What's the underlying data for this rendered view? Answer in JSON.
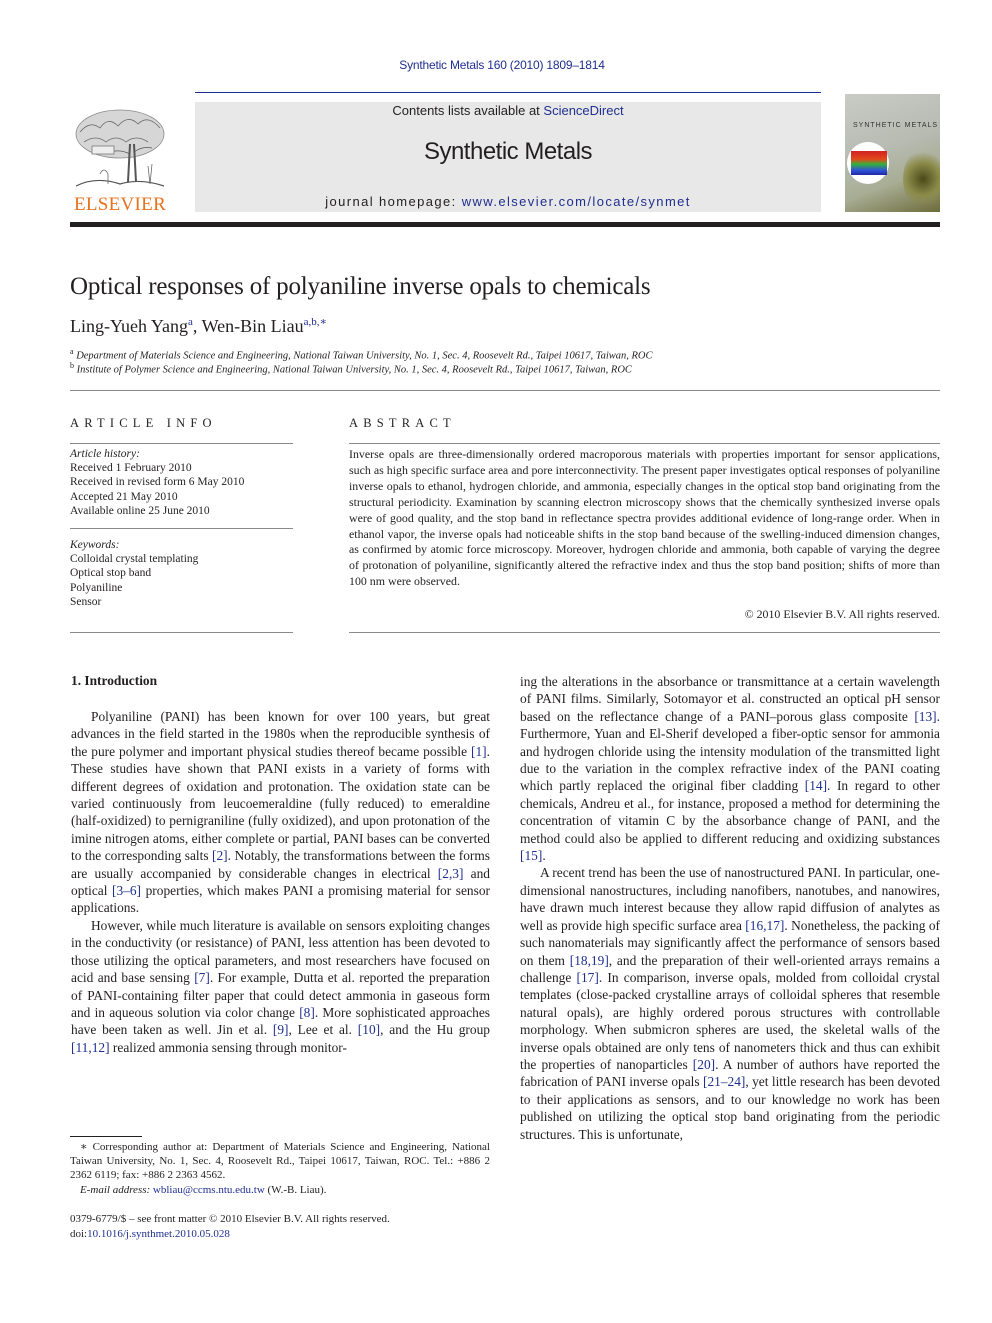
{
  "header": {
    "journal_ref": "Synthetic Metals 160 (2010) 1809–1814",
    "publisher_wordmark": "ELSEVIER",
    "contents_prefix": "Contents lists available at ",
    "contents_link": "ScienceDirect",
    "journal_title": "Synthetic Metals",
    "homepage_prefix": "journal homepage: ",
    "homepage_link": "www.elsevier.com/locate/synmet",
    "cover_title": "SYNTHETIC METALS"
  },
  "colors": {
    "link": "#1f2f8f",
    "elsevier_orange": "#e8711d",
    "masthead_bg": "#e8e8e8",
    "text": "#231f20"
  },
  "article": {
    "title": "Optical responses of polyaniline inverse opals to chemicals",
    "authors": [
      {
        "name": "Ling-Yueh Yang",
        "sup": "a"
      },
      {
        "name": "Wen-Bin Liau",
        "sup": "a,b,∗"
      }
    ],
    "affiliations": [
      {
        "key": "a",
        "text": "Department of Materials Science and Engineering, National Taiwan University, No. 1, Sec. 4, Roosevelt Rd., Taipei 10617, Taiwan, ROC"
      },
      {
        "key": "b",
        "text": "Institute of Polymer Science and Engineering, National Taiwan University, No. 1, Sec. 4, Roosevelt Rd., Taipei 10617, Taiwan, ROC"
      }
    ]
  },
  "article_info": {
    "heading": "ARTICLE INFO",
    "history_label": "Article history:",
    "history": [
      "Received 1 February 2010",
      "Received in revised form 6 May 2010",
      "Accepted 21 May 2010",
      "Available online 25 June 2010"
    ],
    "keywords_label": "Keywords:",
    "keywords": [
      "Colloidal crystal templating",
      "Optical stop band",
      "Polyaniline",
      "Sensor"
    ]
  },
  "abstract": {
    "heading": "ABSTRACT",
    "text": "Inverse opals are three-dimensionally ordered macroporous materials with properties important for sensor applications, such as high specific surface area and pore interconnectivity. The present paper investigates optical responses of polyaniline inverse opals to ethanol, hydrogen chloride, and ammonia, especially changes in the optical stop band originating from the structural periodicity. Examination by scanning electron microscopy shows that the chemically synthesized inverse opals were of good quality, and the stop band in reflectance spectra provides additional evidence of long-range order. When in ethanol vapor, the inverse opals had noticeable shifts in the stop band because of the swelling-induced dimension changes, as confirmed by atomic force microscopy. Moreover, hydrogen chloride and ammonia, both capable of varying the degree of protonation of polyaniline, significantly altered the refractive index and thus the stop band position; shifts of more than 100 nm were observed.",
    "copyright": "© 2010 Elsevier B.V. All rights reserved."
  },
  "intro": {
    "heading": "1.  Introduction",
    "left": {
      "p1": [
        {
          "t": "Polyaniline (PANI) has been known for over 100 years, but great advances in the field started in the 1980s when the reproducible synthesis of the pure polymer and important physical studies thereof became possible "
        },
        {
          "c": "[1]"
        },
        {
          "t": ". These studies have shown that PANI exists in a variety of forms with different degrees of oxidation and protonation. The oxidation state can be varied continuously from leucoemeraldine (fully reduced) to emeraldine (half-oxidized) to pernigraniline (fully oxidized), and upon protonation of the imine nitrogen atoms, either complete or partial, PANI bases can be converted to the corresponding salts "
        },
        {
          "c": "[2]"
        },
        {
          "t": ". Notably, the transformations between the forms are usually accompanied by considerable changes in electrical "
        },
        {
          "c": "[2,3]"
        },
        {
          "t": " and optical "
        },
        {
          "c": "[3–6]"
        },
        {
          "t": " properties, which makes PANI a promising material for sensor applications."
        }
      ],
      "p2": [
        {
          "t": "However, while much literature is available on sensors exploiting changes in the conductivity (or resistance) of PANI, less attention has been devoted to those utilizing the optical parameters, and most researchers have focused on acid and base sensing "
        },
        {
          "c": "[7]"
        },
        {
          "t": ". For example, Dutta et al. reported the preparation of PANI-containing filter paper that could detect ammonia in gaseous form and in aqueous solution via color change "
        },
        {
          "c": "[8]"
        },
        {
          "t": ". More sophisticated approaches have been taken as well. Jin et al. "
        },
        {
          "c": "[9]"
        },
        {
          "t": ", Lee et al. "
        },
        {
          "c": "[10]"
        },
        {
          "t": ", and the Hu group "
        },
        {
          "c": "[11,12]"
        },
        {
          "t": " realized ammonia sensing through monitor-"
        }
      ]
    },
    "right": {
      "p1": [
        {
          "t": "ing the alterations in the absorbance or transmittance at a certain wavelength of PANI films. Similarly, Sotomayor et al. constructed an optical pH sensor based on the reflectance change of a PANI–porous glass composite "
        },
        {
          "c": "[13]"
        },
        {
          "t": ". Furthermore, Yuan and El-Sherif developed a fiber-optic sensor for ammonia and hydrogen chloride using the intensity modulation of the transmitted light due to the variation in the complex refractive index of the PANI coating which partly replaced the original fiber cladding "
        },
        {
          "c": "[14]"
        },
        {
          "t": ". In regard to other chemicals, Andreu et al., for instance, proposed a method for determining the concentration of vitamin C by the absorbance change of PANI, and the method could also be applied to different reducing and oxidizing substances "
        },
        {
          "c": "[15]"
        },
        {
          "t": "."
        }
      ],
      "p2": [
        {
          "t": "A recent trend has been the use of nanostructured PANI. In particular, one-dimensional nanostructures, including nanofibers, nanotubes, and nanowires, have drawn much interest because they allow rapid diffusion of analytes as well as provide high specific surface area "
        },
        {
          "c": "[16,17]"
        },
        {
          "t": ". Nonetheless, the packing of such nanomaterials may significantly affect the performance of sensors based on them "
        },
        {
          "c": "[18,19]"
        },
        {
          "t": ", and the preparation of their well-oriented arrays remains a challenge "
        },
        {
          "c": "[17]"
        },
        {
          "t": ". In comparison, inverse opals, molded from colloidal crystal templates (close-packed crystalline arrays of colloidal spheres that resemble natural opals), are highly ordered porous structures with controllable morphology. When submicron spheres are used, the skeletal walls of the inverse opals obtained are only tens of nanometers thick and thus can exhibit the properties of nanoparticles "
        },
        {
          "c": "[20]"
        },
        {
          "t": ". A number of authors have reported the fabrication of PANI inverse opals "
        },
        {
          "c": "[21–24]"
        },
        {
          "t": ", yet little research has been devoted to their applications as sensors, and to our knowledge no work has been published on utilizing the optical stop band originating from the periodic structures. This is unfortunate,"
        }
      ]
    }
  },
  "footnote": {
    "corresponding": "∗ Corresponding author at: Department of Materials Science and Engineering, National Taiwan University, No. 1, Sec. 4, Roosevelt Rd., Taipei 10617, Taiwan, ROC. Tel.: +886 2 2362 6119; fax: +886 2 2363 4562.",
    "email_label": "E-mail address: ",
    "email": "wbliau@ccms.ntu.edu.tw",
    "email_suffix": " (W.-B. Liau)."
  },
  "frontmatter": {
    "issn_line": "0379-6779/$ – see front matter © 2010 Elsevier B.V. All rights reserved.",
    "doi_prefix": "doi:",
    "doi": "10.1016/j.synthmet.2010.05.028"
  }
}
